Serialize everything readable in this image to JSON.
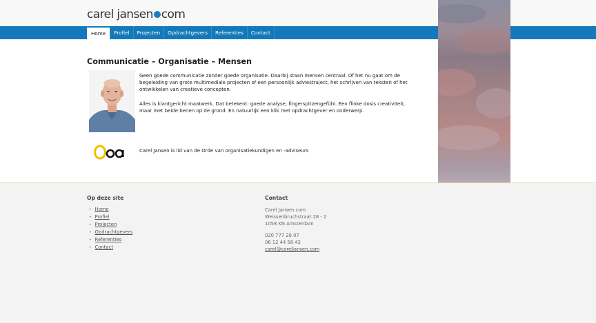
{
  "logo": {
    "part1": "carel jansen",
    "part2": "com",
    "dot_color": "#1a7fc2"
  },
  "nav": {
    "items": [
      {
        "label": "Home",
        "active": true
      },
      {
        "label": "Profiel"
      },
      {
        "label": "Projecten"
      },
      {
        "label": "Opdrachtgevers"
      },
      {
        "label": "Referenties"
      },
      {
        "label": "Contact"
      }
    ],
    "bar_color": "#1479ba"
  },
  "main": {
    "title": "Communicatie – Organisatie – Mensen",
    "paragraph1": "Geen goede communicatie zonder goede organisatie. Daarbij staan mensen centraal. Of het nu gaat om de begeleiding van grote multimediale projecten of een persoonlijk adviestraject, het schrijven van teksten of het ontwikkelen van creatieve concepten.",
    "paragraph2": "Alles is klantgericht maatwerk. Dat betekent: goede analyse, fingerspitzengefühl. Een flinke dosis creativiteit, maar met beide benen op de grond. En natuurlijk een klik met opdrachtgever en onderwerp.",
    "ooa_logo": "Ooa",
    "membership": "Carel Jansen is lid van de Orde van organisatiekundigen en -adviseurs"
  },
  "footer": {
    "site_heading": "Op deze site",
    "site_links": [
      "Home",
      "Profiel",
      "Projecten",
      "Opdrachtgevers",
      "Referenties",
      "Contact"
    ],
    "contact_heading": "Contact",
    "contact": {
      "name": "Carel Jansen.com",
      "street": "Weissenbruchstraat 28 - 2",
      "city": "1058 KN Amsterdam",
      "phone1": "020 777 28 07",
      "phone2": "06 12 44 58 43",
      "email": "carel@careljansen.com"
    }
  }
}
